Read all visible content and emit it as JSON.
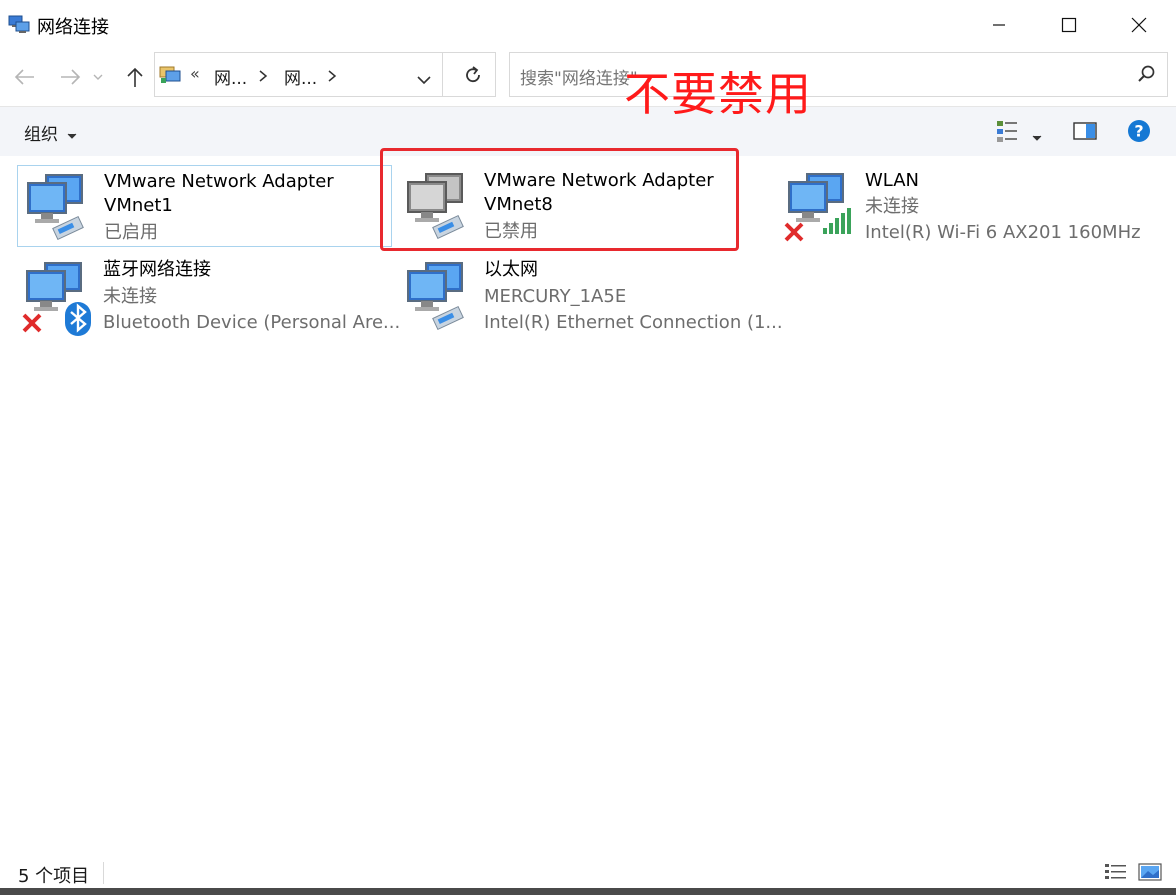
{
  "window": {
    "title": "网络连接"
  },
  "nav": {
    "breadcrumb_prefix": "«",
    "breadcrumb": [
      "网...",
      "网..."
    ]
  },
  "search": {
    "placeholder": "搜索\"网络连接\""
  },
  "toolbar": {
    "organize_label": "组织"
  },
  "annotation": {
    "text": "不要禁用",
    "color": "#e8292e"
  },
  "items": [
    {
      "name1": "VMware Network Adapter",
      "name2": "VMnet1",
      "line1": "已启用",
      "line2": "",
      "icon": "network-adapter-icon",
      "state": "enabled"
    },
    {
      "name1": "VMware Network Adapter",
      "name2": "VMnet8",
      "line1": "已禁用",
      "line2": "",
      "icon": "network-adapter-disabled-icon",
      "state": "disabled"
    },
    {
      "name1": "WLAN",
      "name2": "",
      "line1": "未连接",
      "line2": "Intel(R) Wi-Fi 6 AX201 160MHz",
      "icon": "wlan-adapter-icon",
      "state": "disconnected"
    },
    {
      "name1": "蓝牙网络连接",
      "name2": "",
      "line1": "未连接",
      "line2": "Bluetooth Device (Personal Are...",
      "icon": "bluetooth-adapter-icon",
      "state": "disconnected"
    },
    {
      "name1": "以太网",
      "name2": "",
      "line1": "MERCURY_1A5E",
      "line2": "Intel(R) Ethernet Connection (1...",
      "icon": "ethernet-adapter-icon",
      "state": "connected"
    }
  ],
  "status": {
    "count_text": "5 个项目"
  },
  "colors": {
    "accent": "#1a73c8",
    "selection_border": "#a9d3ee",
    "error_red": "#e8292e",
    "help_blue": "#1478d4"
  }
}
